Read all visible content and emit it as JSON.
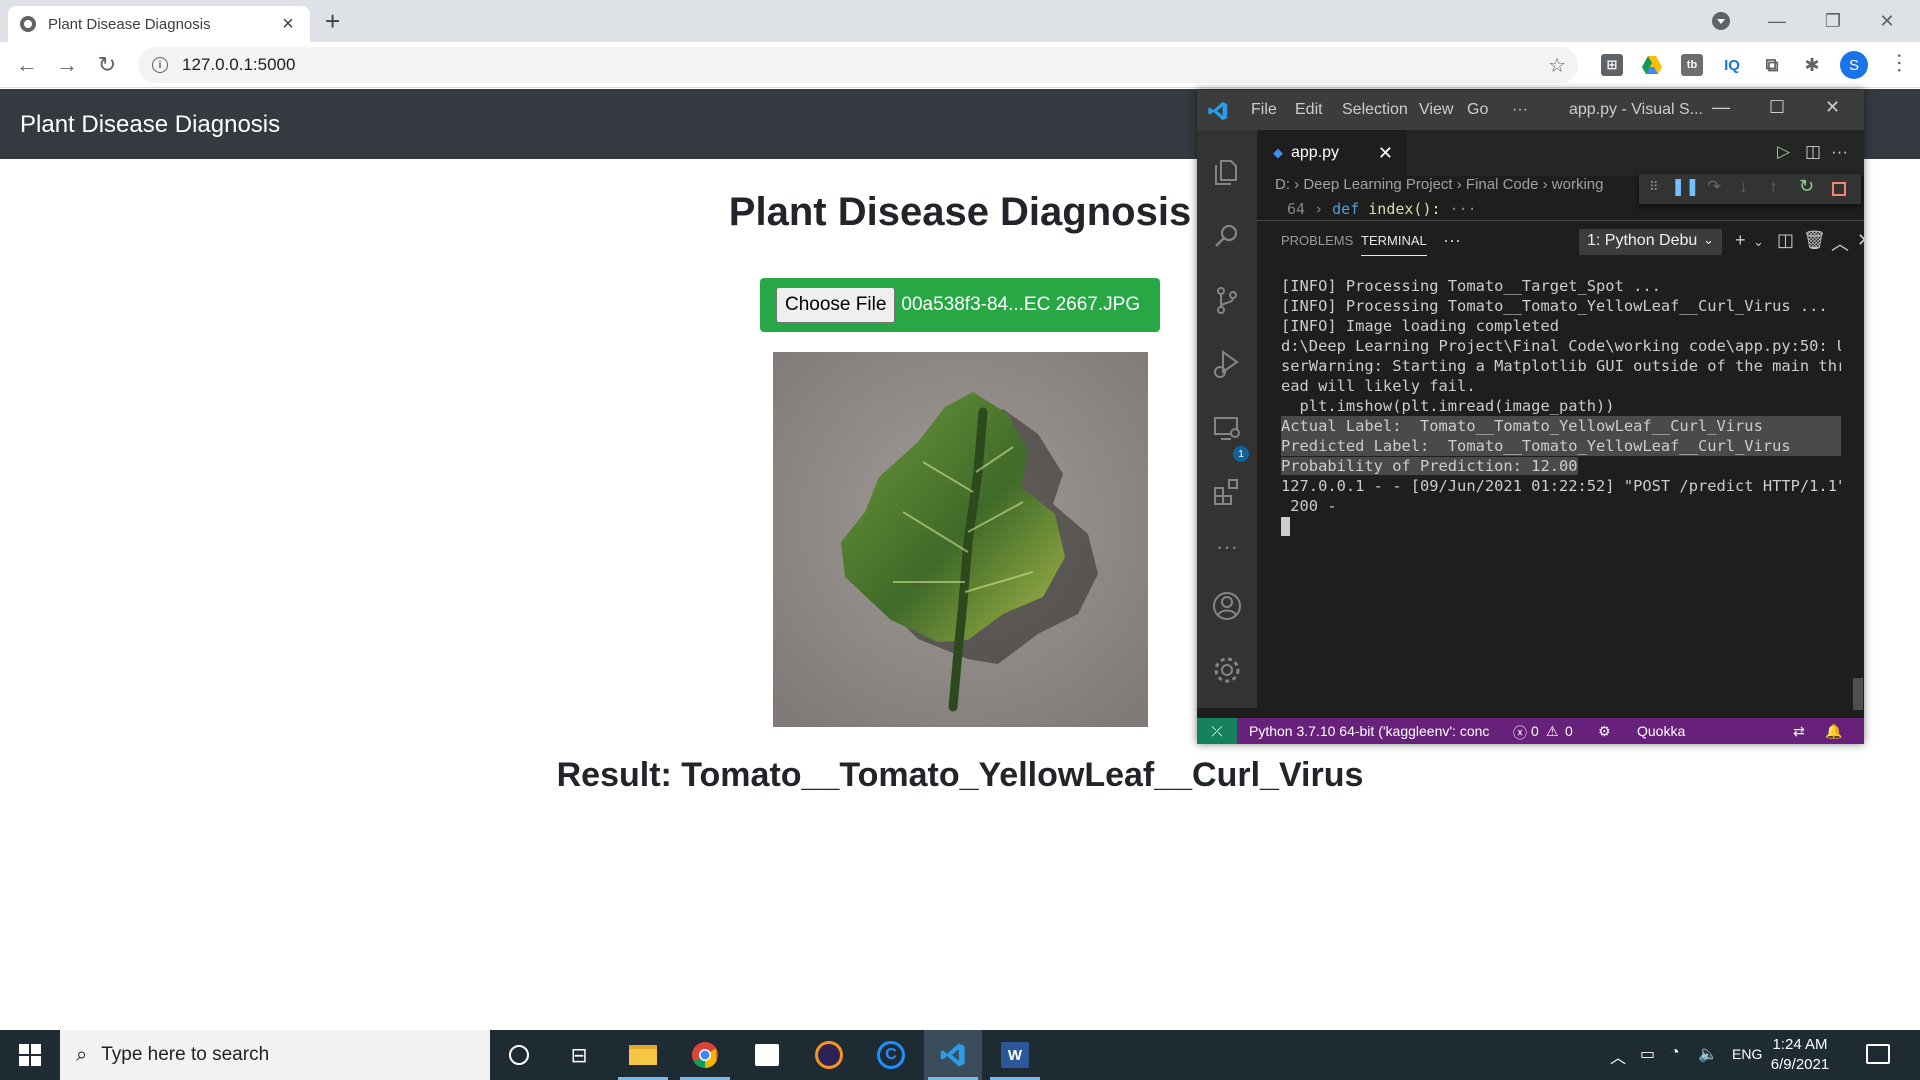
{
  "browser": {
    "tab_title": "Plant Disease Diagnosis",
    "tab_close": "×",
    "new_tab": "+",
    "url": "127.0.0.1:5000"
  },
  "page": {
    "nav_brand": "Plant Disease Diagnosis",
    "heading": "Plant Disease Diagnosis",
    "choose_file_label": "Choose File",
    "file_name": "00a538f3-84...EC 2667.JPG",
    "result": "Result: Tomato__Tomato_YellowLeaf__Curl_Virus"
  },
  "vscode": {
    "menu": [
      "File",
      "Edit",
      "Selection",
      "View",
      "Go",
      "···"
    ],
    "window_title": "app.py - Visual S...",
    "tab_label": "app.py",
    "breadcrumb": "D: › Deep Learning Project › Final Code › working",
    "code_line_number": "64",
    "code_keyword": "def",
    "code_function": "index():",
    "code_ellipsis": "···",
    "panel_tabs": [
      "PROBLEMS",
      "TERMINAL"
    ],
    "terminal_select": "1: Python Debu",
    "debug_badge": "1",
    "terminal_lines": [
      "[INFO] Processing Tomato__Target_Spot ...",
      "[INFO] Processing Tomato__Tomato_YellowLeaf__Curl_Virus ...",
      "[INFO] Image loading completed",
      "d:\\Deep Learning Project\\Final Code\\working code\\app.py:50: U",
      "serWarning: Starting a Matplotlib GUI outside of the main thr",
      "ead will likely fail.",
      "  plt.imshow(plt.imread(image_path))",
      "Actual Label:  Tomato__Tomato_YellowLeaf__Curl_Virus",
      "Predicted Label:  Tomato__Tomato_YellowLeaf__Curl_Virus",
      "Probability of Prediction: 12.00",
      "127.0.0.1 - - [09/Jun/2021 01:22:52] \"POST /predict HTTP/1.1\"",
      " 200 -"
    ],
    "status_python": "Python 3.7.10 64-bit ('kaggleenv': conc",
    "status_errors": "0",
    "status_warnings": "0",
    "status_quokka": "Quokka"
  },
  "taskbar": {
    "search_placeholder": "Type here to search",
    "language": "ENG",
    "time": "1:24 AM",
    "date": "6/9/2021"
  },
  "colors": {
    "navbar": "#343a40",
    "upload_green": "#28a745",
    "vscode_status": "#68217a",
    "taskbar": "#1f2b33"
  }
}
